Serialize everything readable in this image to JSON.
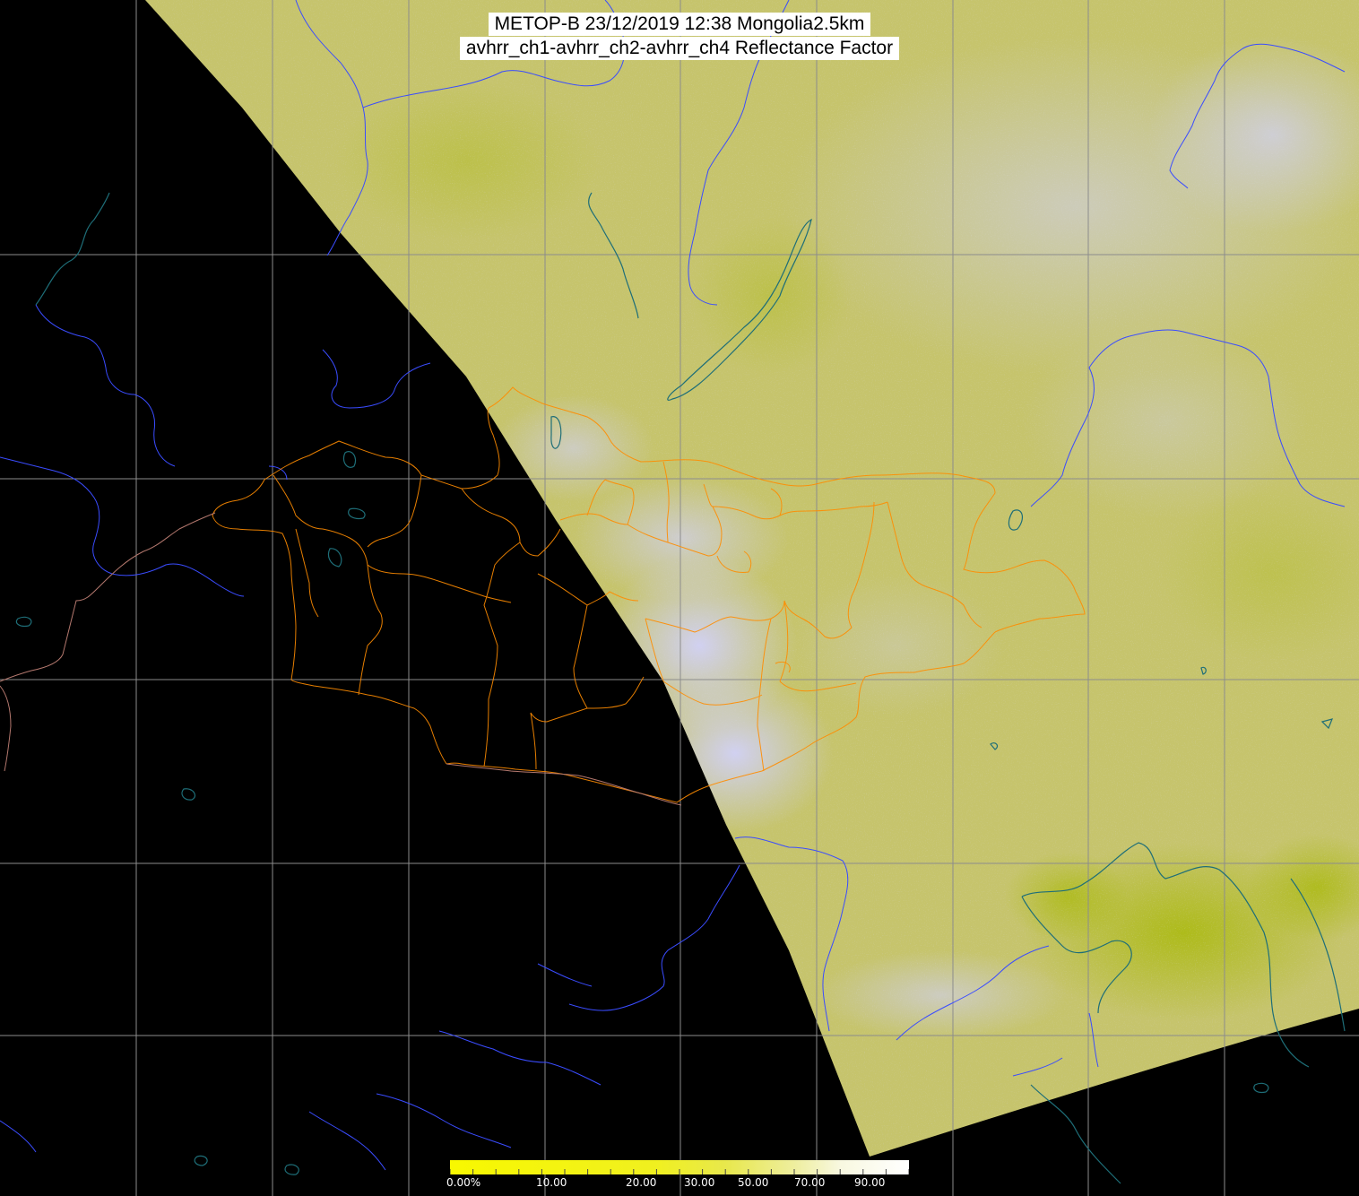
{
  "title": {
    "line1": "METOP-B 23/12/2019 12:38 Mongolia2.5km",
    "line2": "avhrr_ch1-avhrr_ch2-avhrr_ch4 Reflectance Factor"
  },
  "colorbar": {
    "tick_labels": [
      "0.00%",
      "10.00",
      "20.00",
      "30.00",
      "50.00",
      "70.00",
      "90.00"
    ],
    "tick_values": [
      0,
      10,
      20,
      30,
      50,
      70,
      90
    ],
    "colors": [
      "#f6f600",
      "#f2f21a",
      "#eeee3a",
      "#e6e65a",
      "#ecec90",
      "#f4f4c8",
      "#ffffff"
    ]
  },
  "colors": {
    "no_data": "#000000",
    "land_imagery": "#c8c85a",
    "cloud": "#c8c8f0",
    "grid": "#8c8c8c",
    "rivers": "#3a4cff",
    "lakes_coast": "#1e6e78",
    "admin_borders": "#ff8c00",
    "country_border_west": "#b4786e"
  }
}
